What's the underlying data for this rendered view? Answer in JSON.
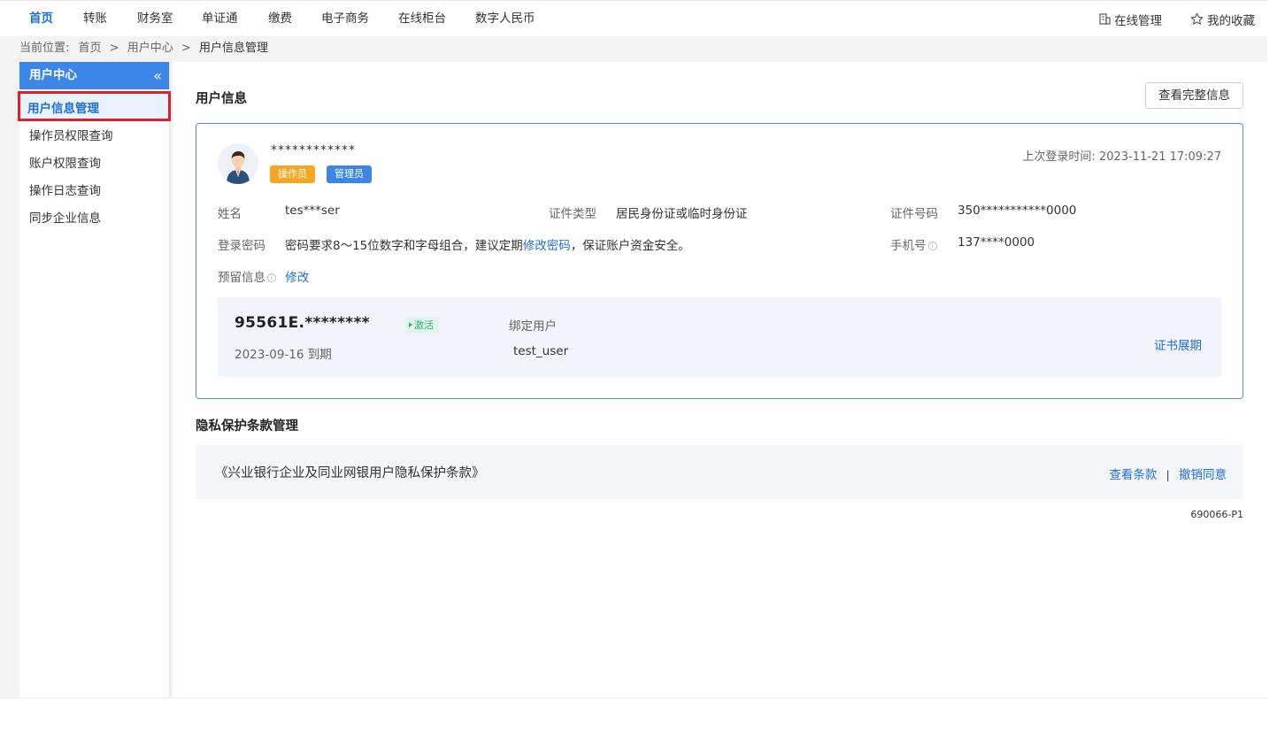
{
  "topnav": {
    "items": [
      {
        "label": "首页",
        "active": true
      },
      {
        "label": "转账",
        "active": false
      },
      {
        "label": "财务室",
        "active": false
      },
      {
        "label": "单证通",
        "active": false
      },
      {
        "label": "缴费",
        "active": false
      },
      {
        "label": "电子商务",
        "active": false
      },
      {
        "label": "在线柜台",
        "active": false
      },
      {
        "label": "数字人民币",
        "active": false
      }
    ],
    "online_manage": "在线管理",
    "favorites": "我的收藏"
  },
  "breadcrumb": {
    "prefix": "当前位置:",
    "items": [
      "首页",
      "用户中心",
      "用户信息管理"
    ],
    "separator": ">"
  },
  "sidebar": {
    "title": "用户中心",
    "collapse_icon": "«",
    "items": [
      {
        "label": "用户信息管理",
        "active": true
      },
      {
        "label": "操作员权限查询",
        "active": false
      },
      {
        "label": "账户权限查询",
        "active": false
      },
      {
        "label": "操作日志查询",
        "active": false
      },
      {
        "label": "同步企业信息",
        "active": false
      }
    ]
  },
  "user_info": {
    "section_title": "用户信息",
    "view_full_button": "查看完整信息",
    "masked_name": "************",
    "badges": [
      "操作员",
      "管理员"
    ],
    "last_login": "上次登录时间: 2023-11-21 17:09:27",
    "fields": {
      "name_label": "姓名",
      "name_value": "tes***ser",
      "id_type_label": "证件类型",
      "id_type_value": "居民身份证或临时身份证",
      "id_no_label": "证件号码",
      "id_no_value": "350***********0000",
      "password_label": "登录密码",
      "password_text_before": "密码要求8～15位数字和字母组合，建议定期",
      "password_link": "修改密码",
      "password_text_after": "，保证账户资金安全。",
      "phone_label": "手机号",
      "phone_value": "137****0000",
      "reserved_label": "预留信息",
      "reserved_link": "修改"
    },
    "certificate": {
      "number": "95561E.********",
      "status": "激活",
      "expire": "2023-09-16 到期",
      "bind_label": "绑定用户",
      "bind_user": "test_user",
      "renew_link": "证书展期"
    }
  },
  "privacy": {
    "section_title": "隐私保护条款管理",
    "clause_name": "《兴业银行企业及同业网银用户隐私保护条款》",
    "view_link": "查看条款",
    "divider": "|",
    "revoke_link": "撤销同意"
  },
  "page_code": "690066-P1",
  "colors": {
    "primary": "#3b86e6",
    "link": "#1f6fd8",
    "badge_operator": "#f5a623",
    "badge_admin": "#3b86e6",
    "status_active": "#27b376",
    "highlight_border": "#e21d2c"
  },
  "icons": {
    "online_manage": "building-icon",
    "favorites": "star-icon",
    "avatar": "user-avatar-icon",
    "info": "info-icon"
  }
}
